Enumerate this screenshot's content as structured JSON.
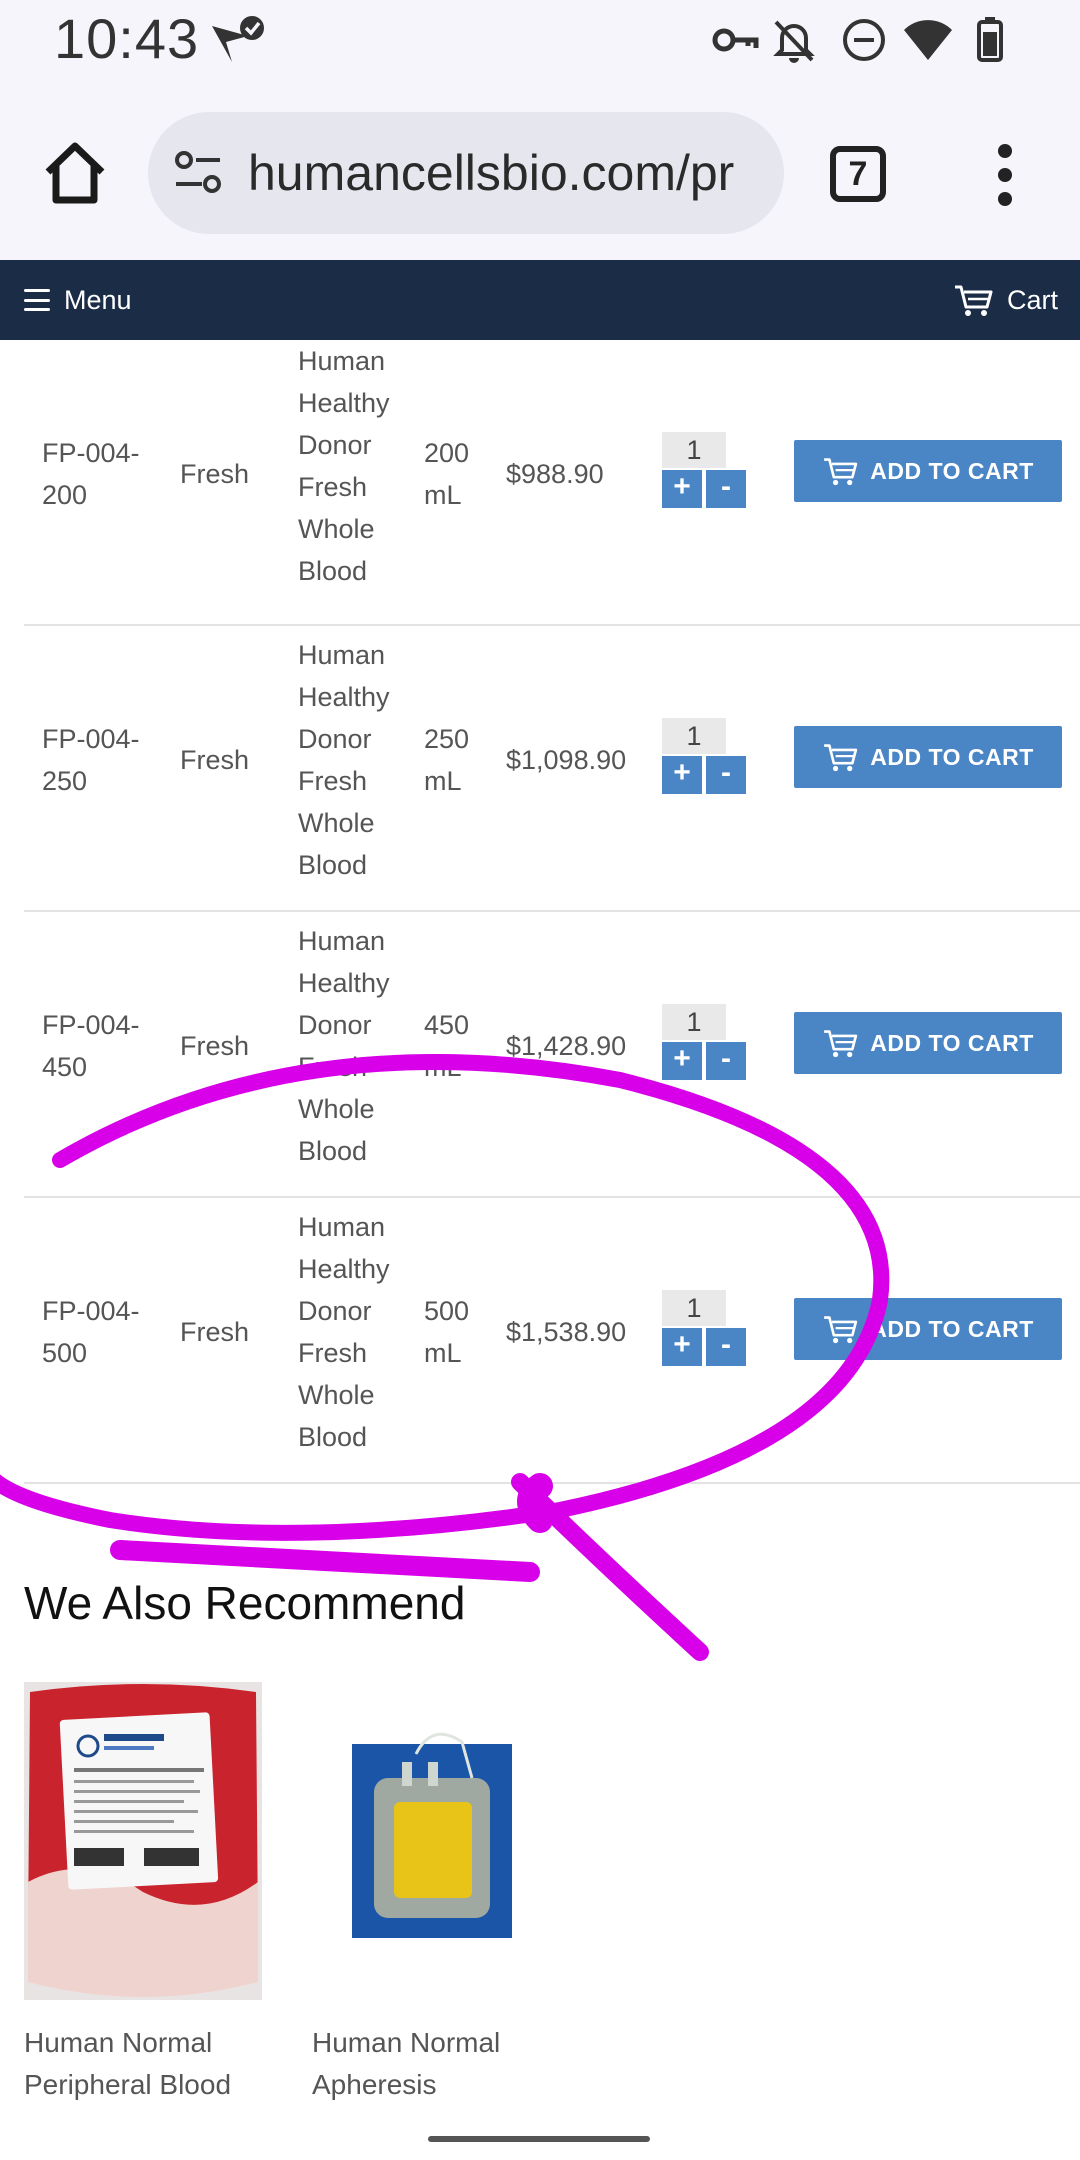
{
  "status_bar": {
    "time": "10:43",
    "icons": [
      "send-check-icon",
      "key-icon",
      "bell-off-icon",
      "do-not-disturb-icon",
      "wifi-icon",
      "battery-icon"
    ]
  },
  "browser": {
    "url": "humancellsbio.com/pr",
    "tab_count": "7",
    "icons": [
      "home-icon",
      "site-settings-icon",
      "more-vert-icon"
    ]
  },
  "nav": {
    "menu_label": "Menu",
    "cart_label": "Cart"
  },
  "products": [
    {
      "sku": "FP-004-200",
      "type": "Fresh",
      "description": "Human Healthy Donor Fresh Whole Blood",
      "size": "200 mL",
      "price": "$988.90",
      "qty": "1",
      "plus": "+",
      "minus": "-",
      "button": "ADD TO CART"
    },
    {
      "sku": "FP-004-250",
      "type": "Fresh",
      "description": "Human Healthy Donor Fresh Whole Blood",
      "size": "250 mL",
      "price": "$1,098.90",
      "qty": "1",
      "plus": "+",
      "minus": "-",
      "button": "ADD TO CART"
    },
    {
      "sku": "FP-004-450",
      "type": "Fresh",
      "description": "Human Healthy Donor Fresh Whole Blood",
      "size": "450 mL",
      "price": "$1,428.90",
      "qty": "1",
      "plus": "+",
      "minus": "-",
      "button": "ADD TO CART"
    },
    {
      "sku": "FP-004-500",
      "type": "Fresh",
      "description": "Human Healthy Donor Fresh Whole Blood",
      "size": "500 mL",
      "price": "$1,538.90",
      "qty": "1",
      "plus": "+",
      "minus": "-",
      "button": "ADD TO CART"
    }
  ],
  "recommend": {
    "title": "We Also Recommend",
    "items": [
      {
        "name": "Human Normal Peripheral Blood"
      },
      {
        "name": "Human Normal Apheresis"
      }
    ]
  },
  "colors": {
    "nav_bg": "#1b2c47",
    "button_blue": "#4a86c5",
    "annotation_magenta": "#d800e8"
  }
}
